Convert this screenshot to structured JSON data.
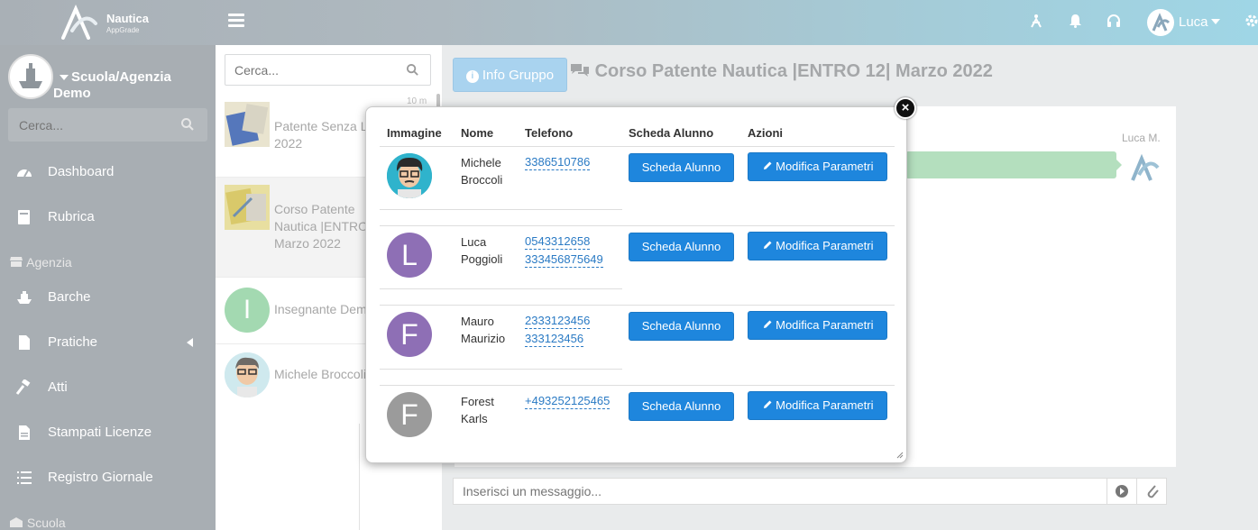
{
  "header": {
    "logo_title": "Nautica",
    "logo_subtitle": "AppGrade",
    "user_name": "Luca",
    "icons": [
      "hamburger-icon",
      "person-sail-icon",
      "bell-icon",
      "headset-icon",
      "user-avatar",
      "gear-icon"
    ]
  },
  "sidebar": {
    "org_line1": "Scuola/Agenzia",
    "org_line2": "Demo",
    "search_placeholder": "Cerca...",
    "items": [
      {
        "label": "Dashboard",
        "icon": "dashboard-icon"
      },
      {
        "label": "Rubrica",
        "icon": "book-icon"
      },
      {
        "label": "Barche",
        "icon": "ship-icon"
      },
      {
        "label": "Pratiche",
        "icon": "file-icon"
      },
      {
        "label": "Atti",
        "icon": "gavel-icon"
      },
      {
        "label": "Stampati Licenze",
        "icon": "document-icon"
      },
      {
        "label": "Registro Giornale",
        "icon": "list-icon"
      }
    ],
    "sections": {
      "agenzia": "Agenzia",
      "scuola": "Scuola"
    }
  },
  "chatlist": {
    "search_placeholder": "Cerca...",
    "items": [
      {
        "name": "Patente Senza L... 2022",
        "line1": "Patente Senza L",
        "line2": "2022",
        "time": "10 m"
      },
      {
        "line1": "Corso Patente",
        "line2": "Nautica |ENTRO",
        "line3": "Marzo 2022"
      },
      {
        "line1": "Insegnante Demo",
        "initial": "I"
      },
      {
        "line1": "Michele Broccoli"
      }
    ]
  },
  "main": {
    "info_button": "Info Gruppo",
    "chat_title": "Corso Patente Nautica |ENTRO 12| Marzo 2022",
    "message_author": "Luca M.",
    "composer_placeholder": "Inserisci un messaggio..."
  },
  "popup": {
    "columns": [
      "Immagine",
      "Nome",
      "Telefono",
      "Scheda Alunno",
      "Azioni"
    ],
    "scheda_label": "Scheda Alunno",
    "modifica_label": "Modifica Parametri",
    "rows": [
      {
        "name1": "Michele",
        "name2": "Broccoli",
        "phones": [
          "3386510786"
        ],
        "avatar": "cartoon",
        "initial": ""
      },
      {
        "name1": "Luca",
        "name2": "Poggioli",
        "phones": [
          "0543312658",
          "333456875649"
        ],
        "avatar": "initial",
        "initial": "L",
        "color": "#8e6fb5"
      },
      {
        "name1": "Mauro",
        "name2": "Maurizio",
        "phones": [
          "2333123456",
          "333123456"
        ],
        "avatar": "initial",
        "initial": "F",
        "color": "#8e6fb5"
      },
      {
        "name1": "Forest",
        "name2": "Karls",
        "phones": [
          "+493252125465"
        ],
        "avatar": "initial",
        "initial": "F",
        "color": "#9b9b9b"
      }
    ]
  },
  "colors": {
    "accent": "#1e86dd",
    "sidebar": "#a8aeb3",
    "bubble": "#b4dfbe"
  }
}
